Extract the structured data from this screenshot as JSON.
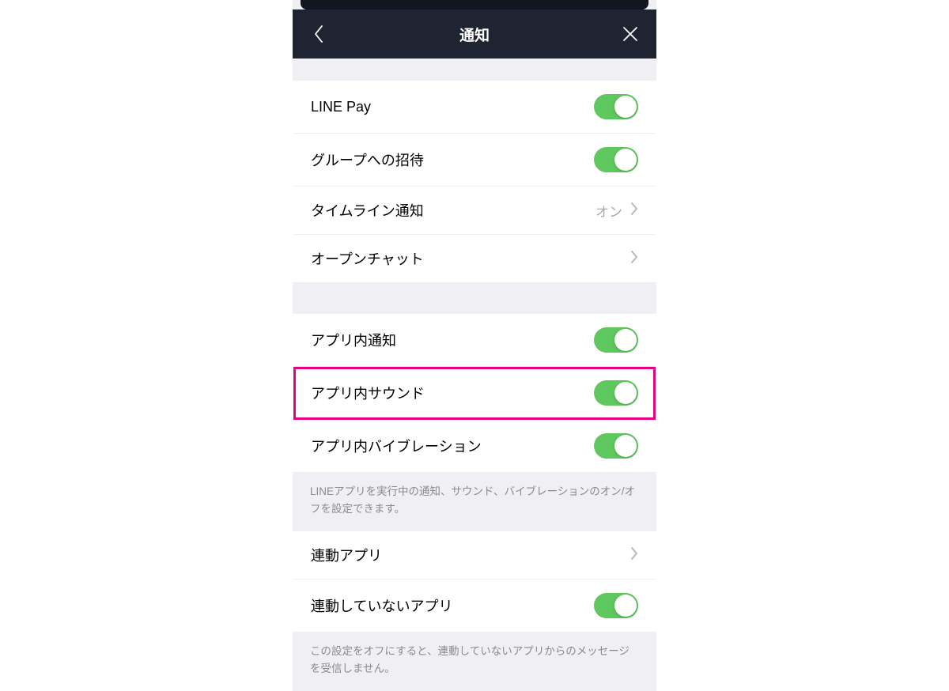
{
  "header": {
    "title": "通知"
  },
  "sections": {
    "s1": {
      "rows": [
        {
          "label": "LINE Pay",
          "type": "toggle",
          "on": true
        },
        {
          "label": "グループへの招待",
          "type": "toggle",
          "on": true
        },
        {
          "label": "タイムライン通知",
          "type": "link",
          "value": "オン"
        },
        {
          "label": "オープンチャット",
          "type": "link"
        }
      ]
    },
    "s2": {
      "rows": [
        {
          "label": "アプリ内通知",
          "type": "toggle",
          "on": true
        },
        {
          "label": "アプリ内サウンド",
          "type": "toggle",
          "on": true,
          "highlighted": true
        },
        {
          "label": "アプリ内バイブレーション",
          "type": "toggle",
          "on": true
        }
      ],
      "footer": "LINEアプリを実行中の通知、サウンド、バイブレーションのオン/オフを設定できます。"
    },
    "s3": {
      "rows": [
        {
          "label": "連動アプリ",
          "type": "link"
        },
        {
          "label": "連動していないアプリ",
          "type": "toggle",
          "on": true
        }
      ],
      "footer": "この設定をオフにすると、連動していないアプリからのメッセージを受信しません。"
    }
  },
  "colors": {
    "header_bg": "#1f2433",
    "toggle_on": "#5ec75e",
    "highlight": "#e6007e",
    "section_bg": "#efeff4"
  }
}
